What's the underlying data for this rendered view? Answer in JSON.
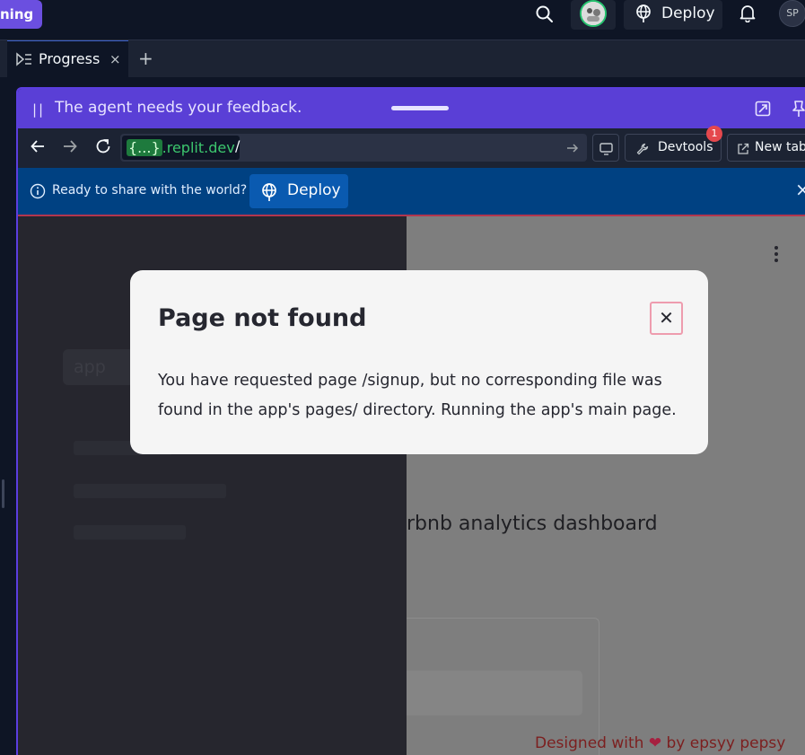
{
  "topbar": {
    "brand_fragment": "ning",
    "deploy_label": "Deploy",
    "user_initials": "SP",
    "icons": [
      "search-icon",
      "avatar",
      "globe-icon",
      "bell-icon"
    ]
  },
  "tabs": {
    "active_label": "Progress",
    "close_glyph": "×",
    "add_glyph": "+"
  },
  "feedback": {
    "pause_glyph": "||",
    "message": "The agent needs your feedback."
  },
  "browser": {
    "host_braces": "{...}",
    "host_suffix": ".replit.dev",
    "path": "/",
    "devtools_label": "Devtools",
    "devtools_badge": "1",
    "newtab_label": "New tab"
  },
  "share": {
    "message": "Ready to share with the world?",
    "deploy_label": "Deploy",
    "close_glyph": "×"
  },
  "app": {
    "nav_item": "app",
    "title_fragment": "rbnb analytics dashboard",
    "footer_prefix": "Designed with",
    "footer_heart": "❤",
    "footer_suffix": "by epsyy pepsy"
  },
  "modal": {
    "title": "Page not found",
    "close_glyph": "✕",
    "body": "You have requested page /signup, but no corresponding file was found in the app's pages/ directory. Running the app's main page."
  },
  "colors": {
    "feedback_bar": "#5a3fd6",
    "share_bar": "#004182",
    "url_host": "#3cc76e",
    "badge": "#e5484d"
  }
}
